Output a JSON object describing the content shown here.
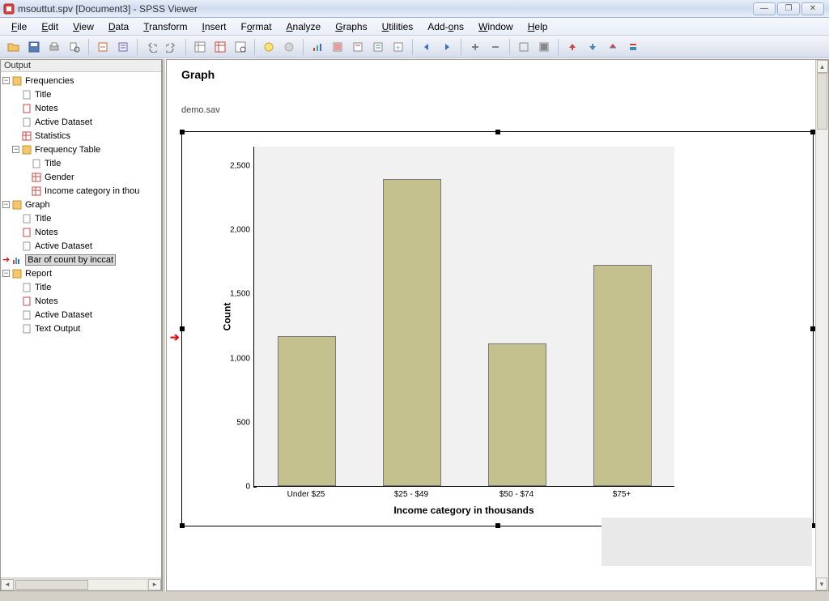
{
  "window": {
    "title": "msouttut.spv [Document3] - SPSS Viewer",
    "controls": {
      "min": "—",
      "max": "❐",
      "close": "✕"
    }
  },
  "menu": {
    "items": [
      {
        "u": "F",
        "rest": "ile"
      },
      {
        "u": "E",
        "rest": "dit"
      },
      {
        "u": "V",
        "rest": "iew"
      },
      {
        "u": "D",
        "rest": "ata"
      },
      {
        "u": "T",
        "rest": "ransform"
      },
      {
        "u": "I",
        "rest": "nsert"
      },
      {
        "u": "",
        "rest": "Format",
        "upre": "F",
        "urest": "o",
        "mid": "rmat"
      },
      {
        "u": "A",
        "rest": "nalyze"
      },
      {
        "u": "G",
        "rest": "raphs"
      },
      {
        "u": "U",
        "rest": "tilities"
      },
      {
        "u": "",
        "rest": "Add-ons",
        "upre": "Add-",
        "urest": "o",
        "mid": "ns"
      },
      {
        "u": "W",
        "rest": "indow"
      },
      {
        "u": "H",
        "rest": "elp"
      }
    ]
  },
  "outline": {
    "title": "Output",
    "frequencies": "Frequencies",
    "title_node": "Title",
    "notes": "Notes",
    "active_dataset": "Active Dataset",
    "statistics": "Statistics",
    "freq_table": "Frequency Table",
    "gender": "Gender",
    "income_cat": "Income category in thou",
    "graph": "Graph",
    "bar_of_count": "Bar of count by inccat",
    "report": "Report",
    "text_output": "Text Output"
  },
  "content": {
    "heading": "Graph",
    "dataset": "demo.sav"
  },
  "chart_data": {
    "type": "bar",
    "categories": [
      "Under $25",
      "$25 - $49",
      "$50 - $74",
      "$75+"
    ],
    "values": [
      1170,
      2390,
      1110,
      1720
    ],
    "title": "",
    "xlabel": "Income category in thousands",
    "ylabel": "Count",
    "yticks": [
      0,
      500,
      1000,
      1500,
      2000,
      2500
    ],
    "ylim": [
      0,
      2650
    ]
  }
}
